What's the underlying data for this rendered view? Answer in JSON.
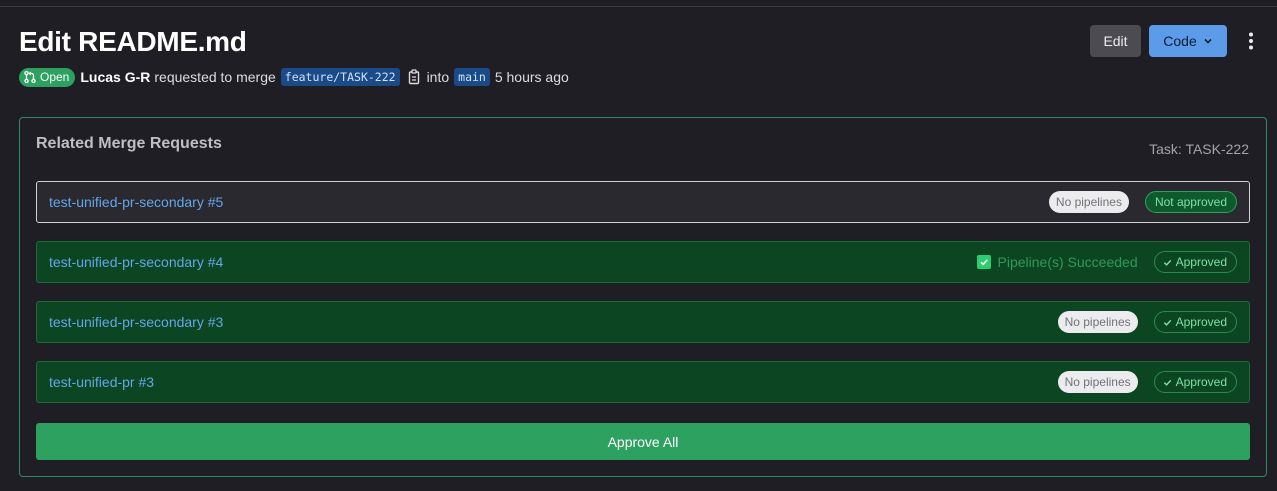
{
  "header": {
    "title": "Edit README.md",
    "edit_label": "Edit",
    "code_label": "Code"
  },
  "meta": {
    "state": "Open",
    "author": "Lucas G-R",
    "action_text": "requested to merge",
    "source_branch": "feature/TASK-222",
    "into_text": "into",
    "target_branch": "main",
    "time_ago": "5 hours ago"
  },
  "related": {
    "title": "Related Merge Requests",
    "task_label": "Task: TASK-222",
    "items": [
      {
        "name": "test-unified-pr-secondary #5",
        "pipeline": "No pipelines",
        "approval": "Not approved",
        "status": "pending"
      },
      {
        "name": "test-unified-pr-secondary #4",
        "pipeline": "Pipeline(s) Succeeded",
        "approval": "Approved",
        "status": "approved"
      },
      {
        "name": "test-unified-pr-secondary #3",
        "pipeline": "No pipelines",
        "approval": "Approved",
        "status": "approved"
      },
      {
        "name": "test-unified-pr #3",
        "pipeline": "No pipelines",
        "approval": "Approved",
        "status": "approved"
      }
    ],
    "approve_all_label": "Approve All"
  },
  "colors": {
    "accent_green": "#2da160",
    "link_blue": "#63a6e9",
    "code_button": "#5b9be8",
    "approved_row": "#0c4521"
  }
}
